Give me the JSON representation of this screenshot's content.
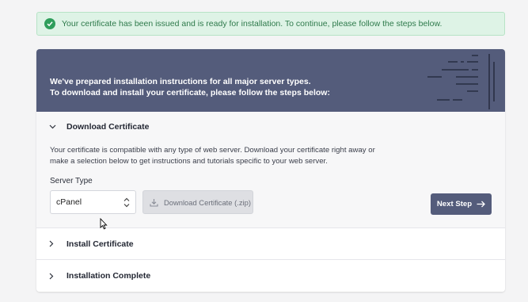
{
  "alert": {
    "message": "Your certificate has been issued and is ready for installation. To continue, please follow the steps below.",
    "icon": "check-circle-icon",
    "color": "#2e9e5b"
  },
  "banner": {
    "line1": "We've prepared installation instructions for all major server types.",
    "line2": "To download and install your certificate, please follow the steps below:",
    "background": "#545c7b"
  },
  "steps": [
    {
      "title": "Download Certificate",
      "expanded": true,
      "description": "Your certificate is compatible with any type of web server. Download your certificate right away or make a selection below to get instructions and tutorials specific to your web server.",
      "server_type_label": "Server Type",
      "server_type_value": "cPanel",
      "download_label": "Download Certificate (.zip)",
      "next_label": "Next Step"
    },
    {
      "title": "Install Certificate",
      "expanded": false
    },
    {
      "title": "Installation Complete",
      "expanded": false
    }
  ]
}
